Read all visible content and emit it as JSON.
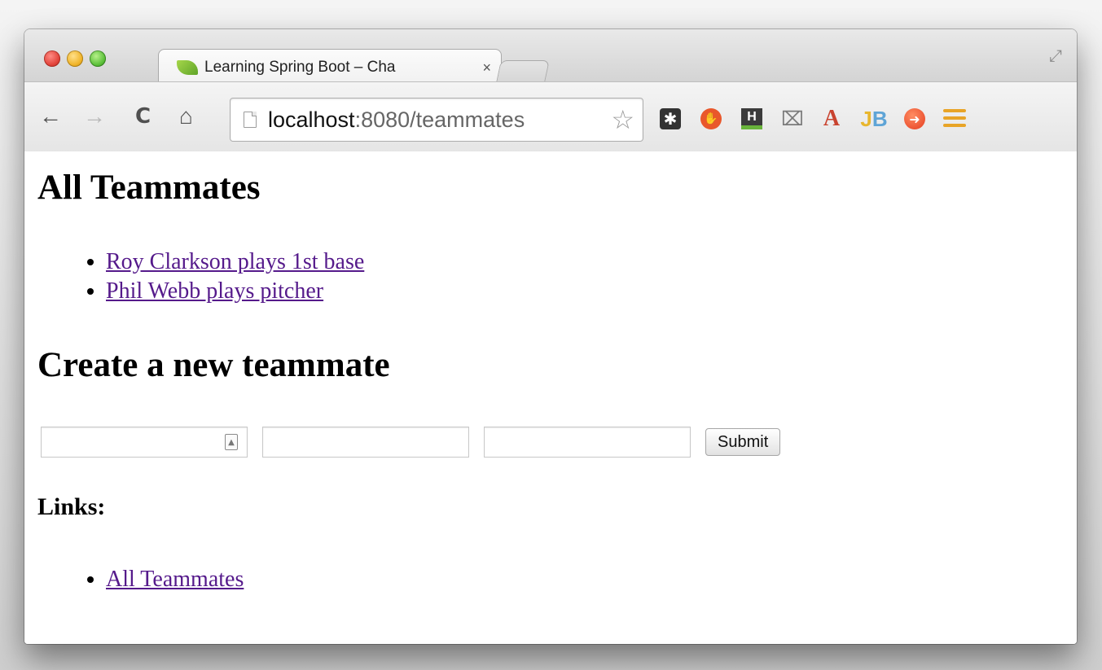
{
  "browser": {
    "tab": {
      "title": "Learning Spring Boot – Cha",
      "close_glyph": "×",
      "favicon": "spring-leaf-icon"
    },
    "address_bar": {
      "host": "localhost",
      "rest": ":8080/teammates"
    },
    "nav": {
      "back_glyph": "←",
      "forward_glyph": "→",
      "reload_glyph": "C",
      "home_glyph": "⌂"
    },
    "extensions": {
      "a_label": "A",
      "jb_j": "J",
      "jb_b": "B",
      "h_label": "H"
    }
  },
  "page": {
    "heading_all": "All Teammates",
    "teammates": [
      "Roy Clarkson plays 1st base",
      "Phil Webb plays pitcher"
    ],
    "heading_create": "Create a new teammate",
    "form": {
      "field1_value": "",
      "field2_value": "",
      "field3_value": "",
      "submit_label": "Submit"
    },
    "heading_links": "Links:",
    "links": [
      "All Teammates"
    ]
  },
  "colors": {
    "visited_link": "#551a8b",
    "favicon": "#7cbf36"
  }
}
